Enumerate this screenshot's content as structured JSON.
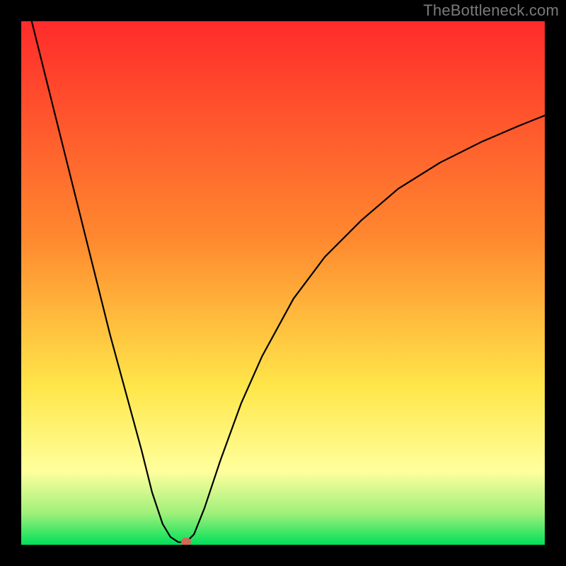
{
  "watermark": "TheBottleneck.com",
  "colors": {
    "red": "#ff2b2b",
    "orange": "#ffa338",
    "yellow": "#ffe74a",
    "pale_yellow": "#ffff9d",
    "green_light": "#78f06a",
    "green": "#00e05a",
    "curve": "#000000",
    "marker": "#cf6a55",
    "frame": "#000000"
  },
  "chart_data": {
    "type": "line",
    "title": "",
    "xlabel": "",
    "ylabel": "",
    "xlim": [
      0,
      100
    ],
    "ylim": [
      0,
      100
    ],
    "gradient_stops": [
      {
        "pos": 0.0,
        "color": "#ff2b2b"
      },
      {
        "pos": 0.42,
        "color": "#ff8a2f"
      },
      {
        "pos": 0.7,
        "color": "#ffe74a"
      },
      {
        "pos": 0.86,
        "color": "#ffff9d"
      },
      {
        "pos": 0.94,
        "color": "#9ff07a"
      },
      {
        "pos": 1.0,
        "color": "#00e05a"
      }
    ],
    "series": [
      {
        "name": "bottleneck-curve",
        "points": [
          {
            "x": 2.0,
            "y": 100.0
          },
          {
            "x": 5.0,
            "y": 88.0
          },
          {
            "x": 8.0,
            "y": 76.0
          },
          {
            "x": 11.0,
            "y": 64.0
          },
          {
            "x": 14.0,
            "y": 52.0
          },
          {
            "x": 17.0,
            "y": 40.0
          },
          {
            "x": 20.0,
            "y": 29.0
          },
          {
            "x": 23.0,
            "y": 18.0
          },
          {
            "x": 25.0,
            "y": 10.0
          },
          {
            "x": 27.0,
            "y": 4.0
          },
          {
            "x": 28.5,
            "y": 1.5
          },
          {
            "x": 30.0,
            "y": 0.5
          },
          {
            "x": 31.5,
            "y": 0.5
          },
          {
            "x": 33.0,
            "y": 2.0
          },
          {
            "x": 35.0,
            "y": 7.0
          },
          {
            "x": 38.0,
            "y": 16.0
          },
          {
            "x": 42.0,
            "y": 27.0
          },
          {
            "x": 46.0,
            "y": 36.0
          },
          {
            "x": 52.0,
            "y": 47.0
          },
          {
            "x": 58.0,
            "y": 55.0
          },
          {
            "x": 65.0,
            "y": 62.0
          },
          {
            "x": 72.0,
            "y": 68.0
          },
          {
            "x": 80.0,
            "y": 73.0
          },
          {
            "x": 88.0,
            "y": 77.0
          },
          {
            "x": 95.0,
            "y": 80.0
          },
          {
            "x": 100.0,
            "y": 82.0
          }
        ]
      }
    ],
    "marker": {
      "x": 31.5,
      "y": 0.5
    }
  }
}
